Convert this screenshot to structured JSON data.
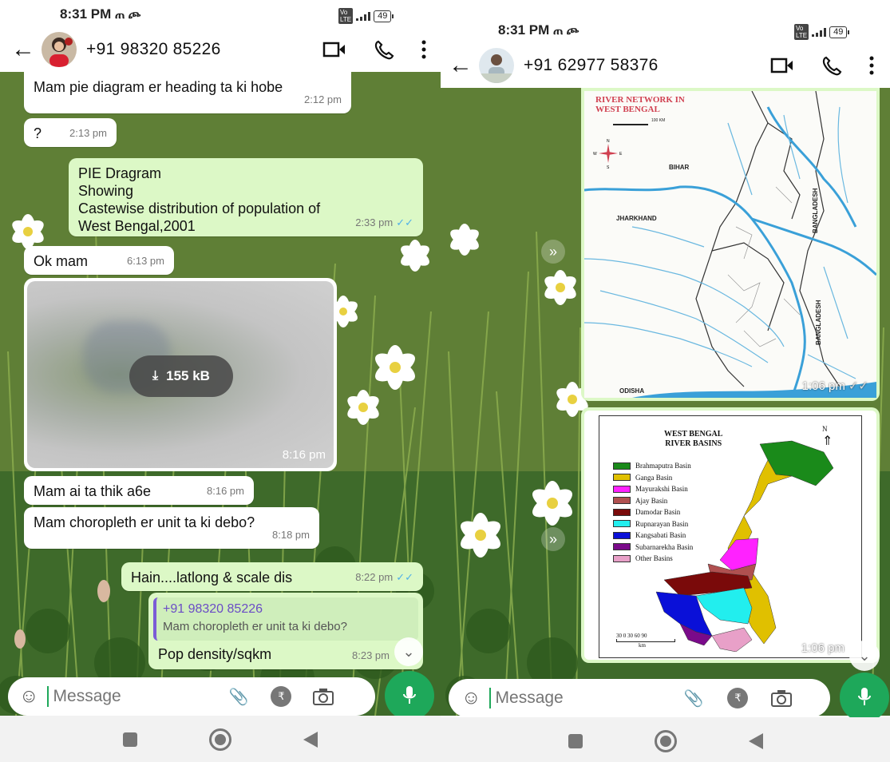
{
  "left": {
    "status_time": "8:31 PM",
    "status_carrier": "ጠ ጮ",
    "battery": "49",
    "contact": "+91 98320 85226",
    "messages": [
      {
        "text": "Mam pie diagram er heading ta ki hobe",
        "time": "2:12 pm"
      },
      {
        "text": "?",
        "time": "2:13 pm"
      },
      {
        "line1": "PIE Dragram",
        "line2": "Showing",
        "line3": "Castewise distribution of population of",
        "line4": "West Bengal,2001",
        "time": "2:33 pm"
      },
      {
        "text": "Ok mam",
        "time": "6:13 pm"
      },
      {
        "download_size": "155 kB",
        "time": "8:16 pm"
      },
      {
        "text": "Mam ai ta thik a6e",
        "time": "8:16 pm"
      },
      {
        "text": "Mam choropleth er unit ta ki debo?",
        "time": "8:18 pm"
      },
      {
        "text": "Hain....latlong & scale dis",
        "time": "8:22 pm"
      },
      {
        "quote_author": "+91 98320 85226",
        "quote_text": "Mam choropleth er unit ta ki debo?",
        "text": "Pop density/sqkm",
        "time": "8:23 pm"
      }
    ],
    "input_placeholder": "Message"
  },
  "right": {
    "status_time": "8:31 PM",
    "status_carrier": "ጠ ጮ",
    "battery": "49",
    "contact": "+91 62977 58376",
    "map1": {
      "title_line1": "RIVER NETWORK IN",
      "title_line2": "WEST BENGAL",
      "scale": "100 KM",
      "labels": [
        "BIHAR",
        "JHARKHAND",
        "BANGLADESH",
        "BANGLADESH",
        "ODISHA"
      ],
      "time": "1:06 pm"
    },
    "map2": {
      "title_line1": "WEST BENGAL",
      "title_line2": "RIVER BASINS",
      "north": "N",
      "legend": [
        {
          "label": "Brahmaputra Basin",
          "color": "#1a8a1a"
        },
        {
          "label": "Ganga Basin",
          "color": "#e0c000"
        },
        {
          "label": "Mayurakshi Basin",
          "color": "#ff22ff"
        },
        {
          "label": "Ajay Basin",
          "color": "#b05050"
        },
        {
          "label": "Damodar Basin",
          "color": "#7a0a0a"
        },
        {
          "label": "Rupnarayan Basin",
          "color": "#22eeee"
        },
        {
          "label": "Kangsabati Basin",
          "color": "#0a10d8"
        },
        {
          "label": "Subarnarekha Basin",
          "color": "#7a0a8a"
        },
        {
          "label": "Other Basins",
          "color": "#e8a0c8"
        }
      ],
      "scale_ticks": "30  0  30  60  90",
      "scale_unit": "km",
      "time": "1:06 pm"
    },
    "input_placeholder": "Message"
  }
}
